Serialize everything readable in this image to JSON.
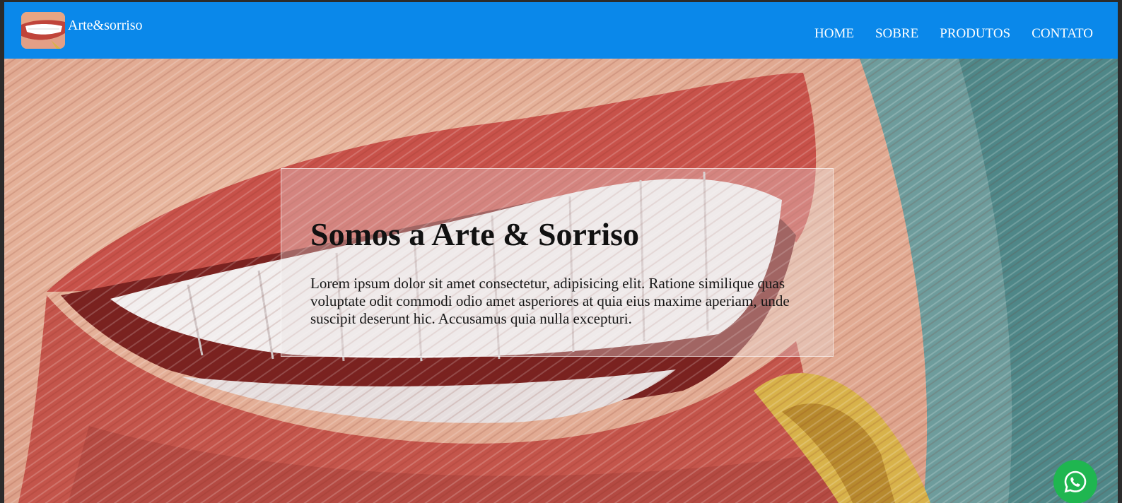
{
  "brand": {
    "name": "Arte&sorriso",
    "logo_icon": "smile-logo-icon"
  },
  "nav": {
    "items": [
      {
        "label": "HOME"
      },
      {
        "label": "SOBRE"
      },
      {
        "label": "PRODUTOS"
      },
      {
        "label": "CONTATO"
      }
    ]
  },
  "hero": {
    "title": "Somos a Arte & Sorriso",
    "text": "Lorem ipsum dolor sit amet consectetur, adipisicing elit. Ratione similique quas voluptate odit commodi odio amet asperiores at quia eius maxime aperiam, unde suscipit deserunt hic. Accusamus quia nulla excepturi.",
    "background_icon": "painted-smile-image"
  },
  "floating": {
    "whatsapp_icon": "whatsapp-icon"
  },
  "colors": {
    "navbar": "#0a88ea",
    "whatsapp": "#1fb650",
    "nav_text": "#ffffff"
  }
}
